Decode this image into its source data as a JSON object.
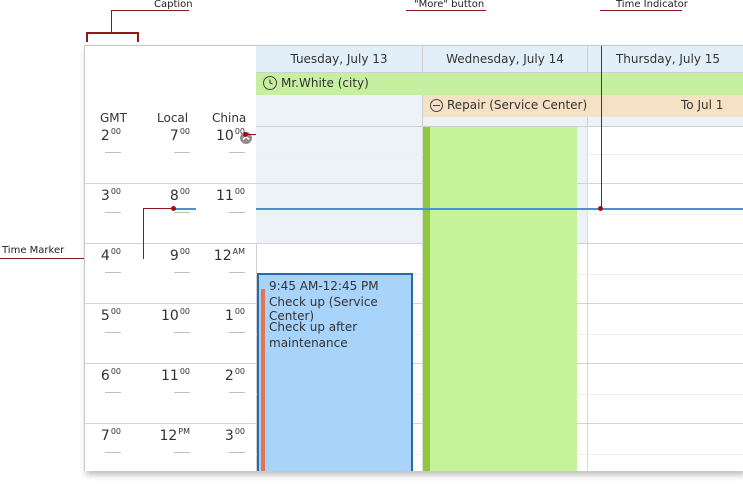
{
  "annotations": {
    "caption": "Caption",
    "more_button": "\"More\" button",
    "time_indicator": "Time Indicator",
    "time_marker": "Time Marker"
  },
  "time_zones": {
    "gmt": {
      "caption": "GMT",
      "hours": [
        "2",
        "3",
        "4",
        "5",
        "6",
        "7"
      ],
      "suffixes": [
        "00",
        "00",
        "00",
        "00",
        "00",
        "00"
      ]
    },
    "local": {
      "caption": "Local",
      "hours": [
        "7",
        "8",
        "9",
        "10",
        "11",
        "12"
      ],
      "suffixes": [
        "00",
        "00",
        "00",
        "00",
        "00",
        "PM"
      ]
    },
    "china": {
      "caption": "China",
      "hours": [
        "10",
        "11",
        "12",
        "1",
        "2",
        "3"
      ],
      "suffixes": [
        "00",
        "00",
        "AM",
        "00",
        "00",
        "00"
      ]
    }
  },
  "days": [
    {
      "header": "Tuesday, July 13"
    },
    {
      "header": "Wednesday, July 14"
    },
    {
      "header": "Thursday, July 15"
    }
  ],
  "all_day": {
    "mrwhite": "Mr.White (city)",
    "repair": "Repair (Service Center)",
    "repair_to": "To Jul 1"
  },
  "appointment": {
    "time": "9:45 AM-12:45 PM",
    "subject": "Check up (Service Center)",
    "description": "Check up after maintenance"
  },
  "colors": {
    "header_bg": "#e3eff8",
    "mrwhite_bg": "#c6f0a0",
    "repair_bg": "#f5e1c4",
    "appointment_bg": "#a8d3fa",
    "appointment_border": "#2b6aa8",
    "status_bar": "#e5734f",
    "green_block": "#c5f29b",
    "green_bar": "#8fc73e",
    "indicator": "#4a90d9",
    "annotation": "#8b1a1a"
  },
  "icons": {
    "clock": "clock-icon",
    "more": "more-arrow-icon",
    "repair": "minus-circle-icon"
  }
}
